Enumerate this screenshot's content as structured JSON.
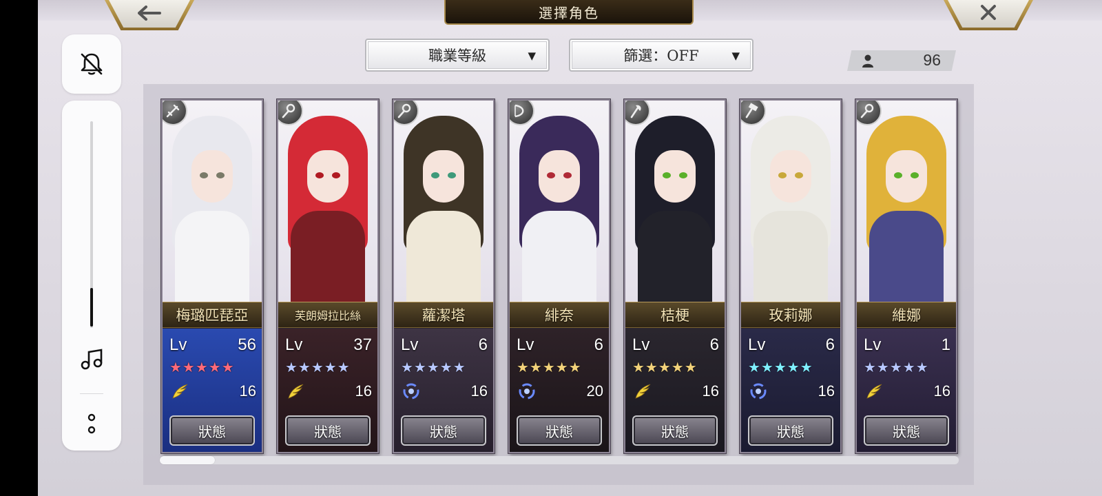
{
  "header": {
    "title": "選擇角色",
    "back_glyph": "🡐",
    "close_glyph": "✕"
  },
  "toolbar": {
    "sort_label": "職業等級",
    "filter_label": "篩選：OFF",
    "caret": "▼",
    "character_count": "96"
  },
  "colors": {
    "gold_trim": "#c9a95a",
    "name_text": "#f3e3b6",
    "star_red": "#ff6a7a",
    "star_blue": "#b8c8ff",
    "star_gold": "#f2d27a",
    "star_cyan": "#7ff0ff"
  },
  "characters": [
    {
      "name": "梅璐匹琵亞",
      "lv_label": "Lv",
      "level": "56",
      "stars": "★★★★★",
      "star_color": "#ff6a7a",
      "element": "wing-icon",
      "cost": "16",
      "status_label": "狀態",
      "class_icon": "sword-icon",
      "hair": "#e8e8ee",
      "outfit": "#f4f4f6",
      "eye": "#7a7a68",
      "stats_bg": "linear-gradient(180deg,#2a4ab0 0%,#1a2e80 100%)"
    },
    {
      "name": "芙朗姆拉比絲",
      "lv_label": "Lv",
      "level": "37",
      "stars": "★★★★★",
      "star_color": "#b8c8ff",
      "element": "wing-icon",
      "cost": "16",
      "status_label": "狀態",
      "class_icon": "staff-icon",
      "hair": "#d42a36",
      "outfit": "#7a1e24",
      "eye": "#b01a22",
      "stats_bg": "linear-gradient(180deg,#3a2228 0%,#221418 100%)"
    },
    {
      "name": "蘿潔塔",
      "lv_label": "Lv",
      "level": "6",
      "stars": "★★★★★",
      "star_color": "#b8c8ff",
      "element": "swirl-icon",
      "cost": "16",
      "status_label": "狀態",
      "class_icon": "staff-icon",
      "hair": "#3e3426",
      "outfit": "#efe8d8",
      "eye": "#3e9a7a",
      "stats_bg": "linear-gradient(180deg,#3e3444 0%,#261f2c 100%)"
    },
    {
      "name": "緋奈",
      "lv_label": "Lv",
      "level": "6",
      "stars": "★★★★★",
      "star_color": "#f2d27a",
      "element": "swirl-icon",
      "cost": "20",
      "status_label": "狀態",
      "class_icon": "bow-icon",
      "hair": "#3a2a5a",
      "outfit": "#f0f0f4",
      "eye": "#b02a36",
      "stats_bg": "linear-gradient(180deg,#2e2228 0%,#1a1418 100%)"
    },
    {
      "name": "桔梗",
      "lv_label": "Lv",
      "level": "6",
      "stars": "★★★★★",
      "star_color": "#f2d27a",
      "element": "wing-icon",
      "cost": "16",
      "status_label": "狀態",
      "class_icon": "axe-icon",
      "hair": "#1e1e2a",
      "outfit": "#22222a",
      "eye": "#5ab02a",
      "stats_bg": "linear-gradient(180deg,#2a262e 0%,#1a1820 100%)"
    },
    {
      "name": "玫莉娜",
      "lv_label": "Lv",
      "level": "6",
      "stars": "★★★★★",
      "star_color": "#7ff0ff",
      "element": "swirl-icon",
      "cost": "16",
      "status_label": "狀態",
      "class_icon": "hammer-icon",
      "hair": "#ecebe6",
      "outfit": "#e6e4dc",
      "eye": "#c8a83a",
      "stats_bg": "linear-gradient(180deg,#2a2a48 0%,#1a1a30 100%)"
    },
    {
      "name": "維娜",
      "lv_label": "Lv",
      "level": "1",
      "stars": "★★★★★",
      "star_color": "#b8c8ff",
      "element": "wing-icon",
      "cost": "16",
      "status_label": "狀態",
      "class_icon": "staff-icon",
      "hair": "#e0b23a",
      "outfit": "#4a4a8a",
      "eye": "#5ab02a",
      "stats_bg": "linear-gradient(180deg,#3a3050 0%,#221c32 100%)"
    }
  ]
}
